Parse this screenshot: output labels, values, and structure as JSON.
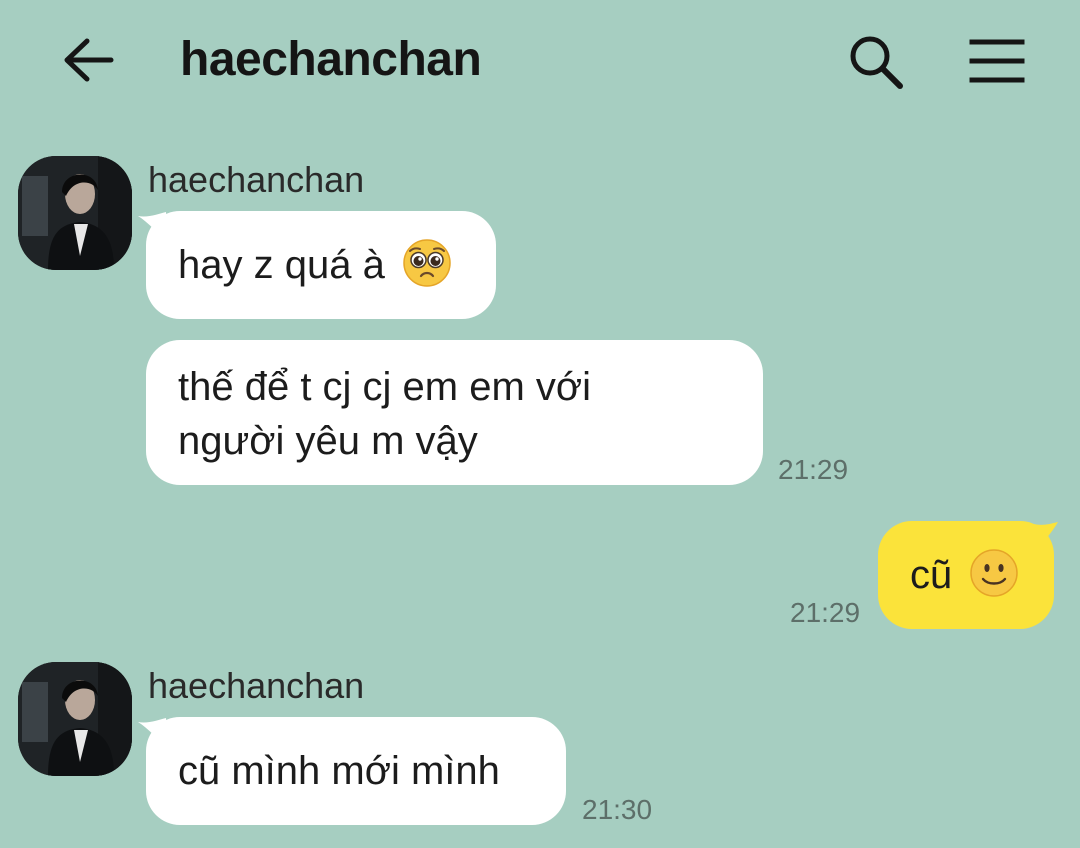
{
  "header": {
    "title": "haechanchan",
    "back_icon": "arrow-left-icon",
    "search_icon": "search-icon",
    "menu_icon": "menu-icon"
  },
  "colors": {
    "background": "#a6cec1",
    "incoming_bubble": "#ffffff",
    "outgoing_bubble": "#fbe33a",
    "timestamp": "#5d6f69"
  },
  "messages": {
    "group1": {
      "sender": "haechanchan",
      "bubble1": {
        "text": "hay z quá à",
        "emoji": "pleading-face-emoji"
      },
      "bubble2": {
        "line1": "thế để t cj cj em em với",
        "line2": "người yêu m vậy"
      },
      "time": "21:29"
    },
    "outgoing": {
      "text": "cũ",
      "emoji": "slightly-smiling-face-emoji",
      "time": "21:29"
    },
    "group2": {
      "sender": "haechanchan",
      "bubble1": {
        "text": "cũ mình mới mình"
      },
      "time": "21:30"
    }
  }
}
